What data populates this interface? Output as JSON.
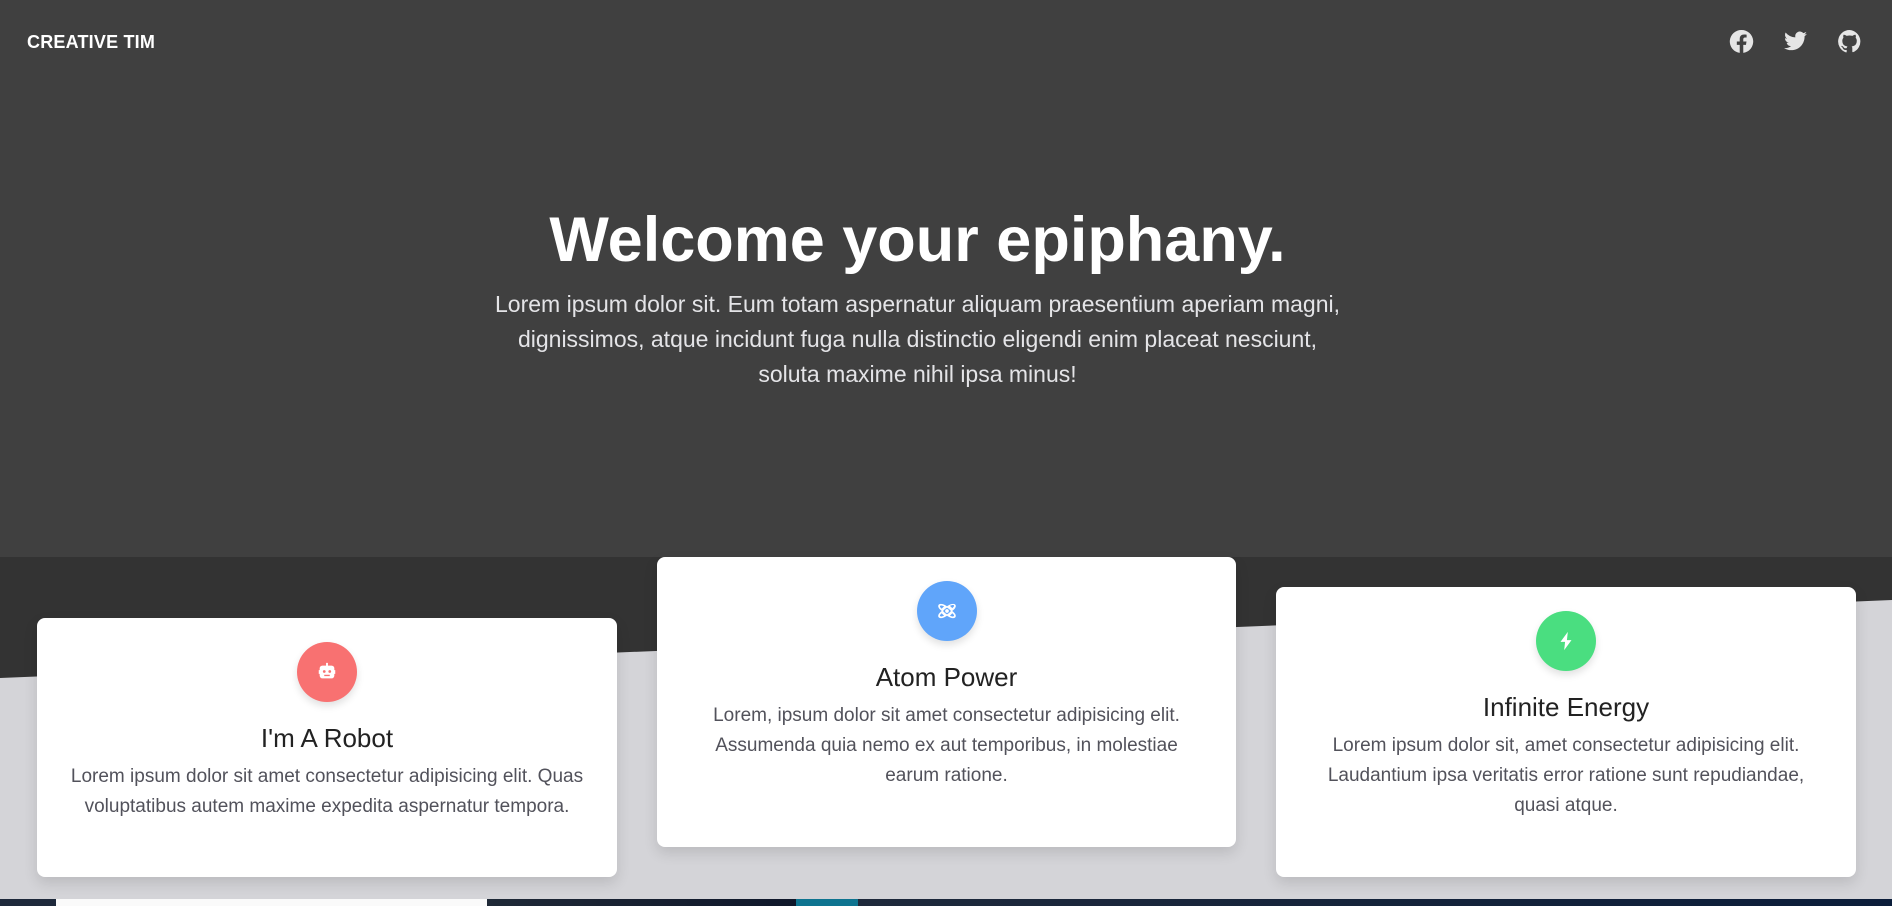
{
  "header": {
    "brand": "CREATIVE TIM",
    "social": [
      {
        "name": "facebook",
        "icon": "facebook-icon"
      },
      {
        "name": "twitter",
        "icon": "twitter-icon"
      },
      {
        "name": "github",
        "icon": "github-icon"
      }
    ]
  },
  "hero": {
    "title": "Welcome your epiphany.",
    "text_line1": "Lorem ipsum dolor sit. Eum totam aspernatur aliquam praesentium aperiam magni,",
    "text_line2": "dignissimos, atque incidunt fuga nulla distinctio eligendi enim placeat nesciunt,",
    "text_line3": "soluta maxime nihil ipsa minus!"
  },
  "features": [
    {
      "title": "I'm A Robot",
      "text_line1": "Lorem ipsum dolor sit amet consectetur adipisicing elit. Quas",
      "text_line2": "voluptatibus autem maxime expedita aspernatur tempora.",
      "icon": "robot-icon",
      "color": "#f87171"
    },
    {
      "title": "Atom Power",
      "text_line1": "Lorem, ipsum dolor sit amet consectetur adipisicing elit.",
      "text_line2": "Assumenda quia nemo ex aut temporibus, in molestiae",
      "text_line3": "earum ratione.",
      "icon": "atom-icon",
      "color": "#60a5fa"
    },
    {
      "title": "Infinite Energy",
      "text_line1": "Lorem ipsum dolor sit, amet consectetur adipisicing elit.",
      "text_line2": "Laudantium ipsa veritatis error ratione sunt repudiandae,",
      "text_line3": "quasi atque.",
      "icon": "bolt-icon",
      "color": "#4ade80"
    }
  ],
  "colors": {
    "hero_bg": "#404040",
    "band_dark": "#333333",
    "band_light": "#d4d4d8"
  }
}
